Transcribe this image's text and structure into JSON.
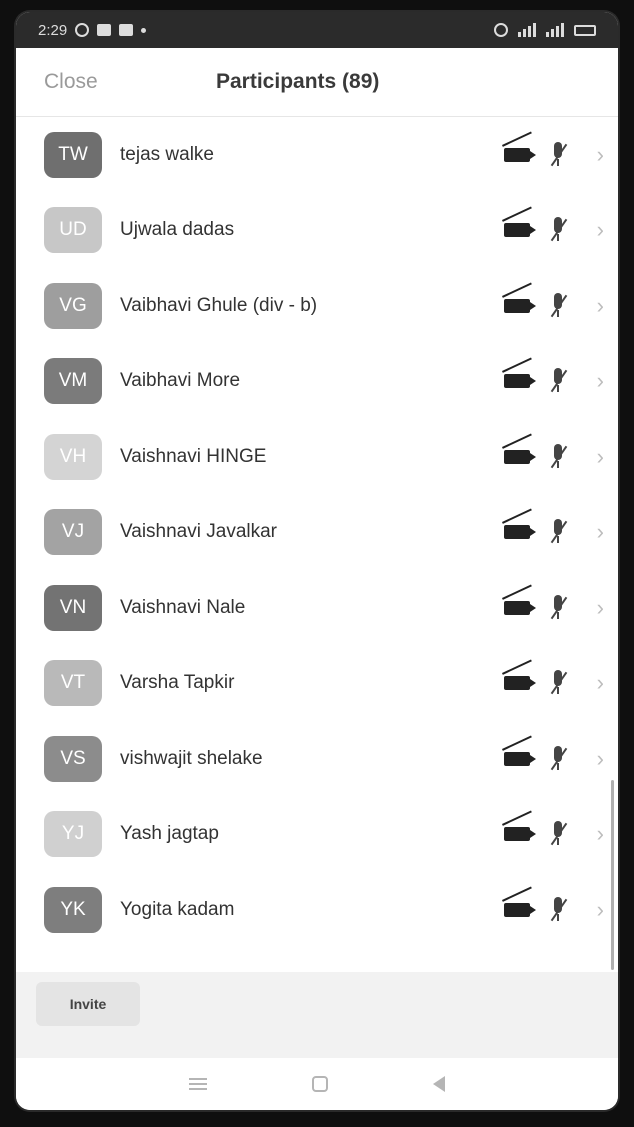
{
  "status_bar": {
    "time": "2:29"
  },
  "header": {
    "close_label": "Close",
    "title": "Participants (89)"
  },
  "participants": [
    {
      "initials": "TW",
      "name": "tejas walke",
      "color": "#6f6f6f"
    },
    {
      "initials": "UD",
      "name": "Ujwala dadas",
      "color": "#c7c7c7"
    },
    {
      "initials": "VG",
      "name": "Vaibhavi Ghule (div - b)",
      "color": "#9e9e9e"
    },
    {
      "initials": "VM",
      "name": "Vaibhavi More",
      "color": "#7b7b7b"
    },
    {
      "initials": "VH",
      "name": "Vaishnavi HINGE",
      "color": "#d4d4d4"
    },
    {
      "initials": "VJ",
      "name": "Vaishnavi Javalkar",
      "color": "#a3a3a3"
    },
    {
      "initials": "VN",
      "name": "Vaishnavi Nale",
      "color": "#737373"
    },
    {
      "initials": "VT",
      "name": "Varsha Tapkir",
      "color": "#b9b9b9"
    },
    {
      "initials": "VS",
      "name": "vishwajit shelake",
      "color": "#8c8c8c"
    },
    {
      "initials": "YJ",
      "name": "Yash jagtap",
      "color": "#d0d0d0"
    },
    {
      "initials": "YK",
      "name": "Yogita kadam",
      "color": "#7e7e7e"
    }
  ],
  "footer": {
    "invite_label": "Invite"
  }
}
